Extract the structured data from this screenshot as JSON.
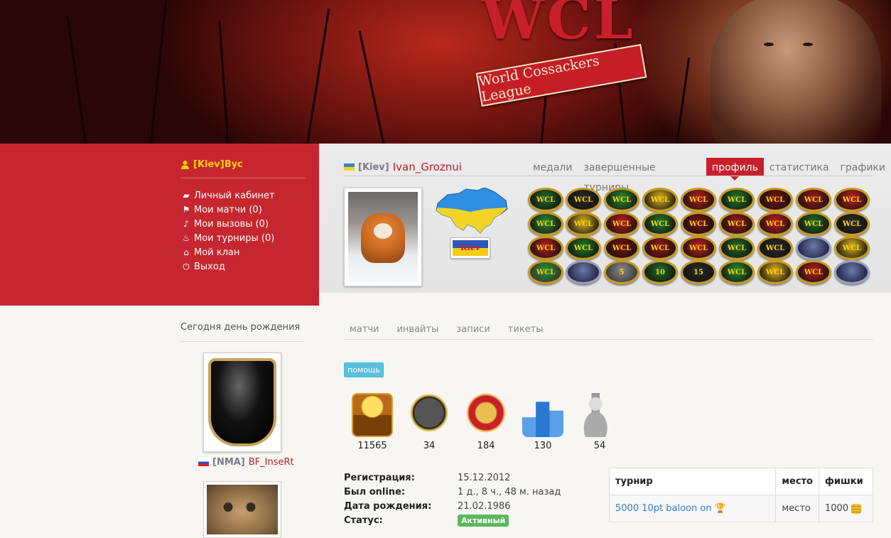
{
  "banner": {
    "logo": "WCL",
    "ribbon": "World Cossackers League"
  },
  "sidebar": {
    "user": "[Kiev]Bус",
    "menu": [
      {
        "icon": "folder-icon",
        "label": "Личный кабинет"
      },
      {
        "icon": "flag-icon",
        "label": "Мои матчи (0)"
      },
      {
        "icon": "bell-icon",
        "label": "Мои вызовы (0)"
      },
      {
        "icon": "fire-icon",
        "label": "Мои турниры (0)"
      },
      {
        "icon": "home-icon",
        "label": "Мой клан"
      },
      {
        "icon": "power-icon",
        "label": "Выход"
      }
    ],
    "birthday_title": "Сегодня день рождения",
    "birthday_user": {
      "clan": "[NMA]",
      "name": "BF_InseRt"
    }
  },
  "profile": {
    "clan": "[Kiev]",
    "name": "Ivan_Groznui",
    "tabs": [
      "медали",
      "завершенные турниры",
      "профиль",
      "статистика",
      "графики"
    ],
    "active_tab": "профиль",
    "city_badge": "Kiev",
    "medals": [
      "WCL",
      "WCL",
      "WCL",
      "WCL",
      "WCL",
      "WCL",
      "WCL",
      "WCL",
      "WCL",
      "WCL",
      "WCL",
      "WCL",
      "WCL",
      "WCL",
      "WCL",
      "WCL",
      "WCL",
      "WCL",
      "WCL",
      "WCL",
      "WCL",
      "WCL",
      "WCL",
      "WCL",
      "WCL",
      "",
      "WCL",
      "WCL",
      "",
      "5",
      "10",
      "15",
      "WCL",
      "WCL",
      "WCL",
      "",
      ""
    ]
  },
  "subtabs": [
    "матчи",
    "инвайты",
    "записи",
    "тикеты"
  ],
  "help_label": "помощь",
  "stats": [
    {
      "icon": "treasure-chest-icon",
      "value": "11565"
    },
    {
      "icon": "medal-badge-icon",
      "value": "34"
    },
    {
      "icon": "shield-badge-icon",
      "value": "184"
    },
    {
      "icon": "podium-icon",
      "value": "130"
    },
    {
      "icon": "chess-pawn-icon",
      "value": "54"
    }
  ],
  "info": [
    {
      "label": "Регистрация:",
      "value": "15.12.2012"
    },
    {
      "label": "Был online:",
      "value": "1 д., 8 ч., 48 м. назад"
    },
    {
      "label": "Дата рождения:",
      "value": "21.02.1986"
    },
    {
      "label": "Статус:",
      "value": "Активный"
    }
  ],
  "table": {
    "headers": [
      "турнир",
      "место",
      "фишки"
    ],
    "rows": [
      {
        "tournament": "5000 10pt baloon on",
        "place": "место",
        "chips": "1000"
      }
    ]
  },
  "colors": {
    "accent_red": "#c6262f",
    "gold": "#ffd200",
    "link_blue": "#3a7cc9",
    "status_green": "#5cb85c",
    "help_blue": "#5bc0de"
  }
}
